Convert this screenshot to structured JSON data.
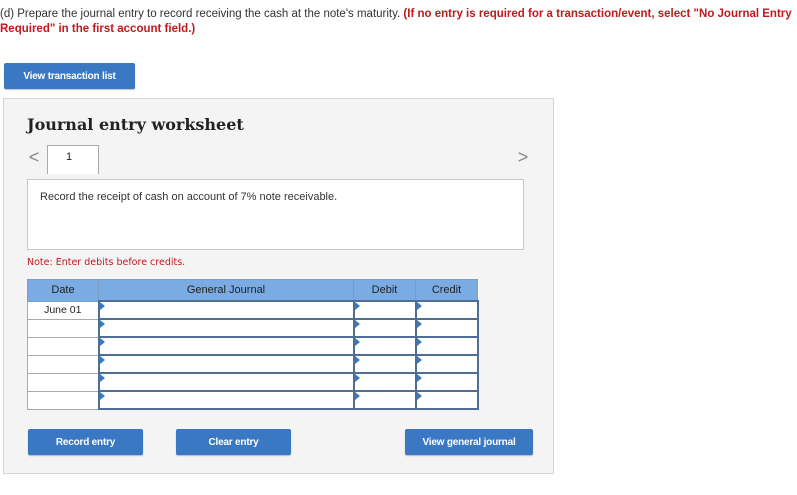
{
  "prompt": {
    "lead": "(d) Prepare the journal entry to record receiving the cash at the note's maturity.",
    "emphasis": "(If no entry is required for a transaction/event, select \"No Journal Entry Required\" in the first account field.)"
  },
  "buttons": {
    "view_transaction_list": "View transaction list",
    "record_entry": "Record entry",
    "clear_entry": "Clear entry",
    "view_general_journal": "View general journal"
  },
  "worksheet": {
    "title": "Journal entry worksheet",
    "nav_prev": "<",
    "nav_next": ">",
    "page_number": "1",
    "description": "Record the receipt of cash on account of 7% note receivable.",
    "note": "Note: Enter debits before credits."
  },
  "table": {
    "headers": {
      "date": "Date",
      "journal": "General Journal",
      "debit": "Debit",
      "credit": "Credit"
    },
    "rows": [
      {
        "date": "June 01"
      },
      {
        "date": ""
      },
      {
        "date": ""
      },
      {
        "date": ""
      },
      {
        "date": ""
      },
      {
        "date": ""
      }
    ]
  },
  "colors": {
    "accent_button": "#3b78c4",
    "header_fill": "#7aabe3",
    "emphasis_red": "#c0191d"
  }
}
